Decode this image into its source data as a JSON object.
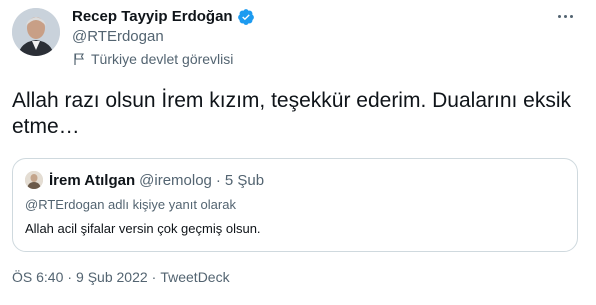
{
  "author": {
    "name": "Recep Tayyip Erdoğan",
    "handle": "@RTErdogan",
    "affiliation": "Türkiye devlet görevlisi",
    "verified_icon": "verified-badge-icon",
    "verified_color": "#1d9bf0"
  },
  "tweet": {
    "text": "Allah razı olsun İrem kızım, teşekkür ederim. Dualarını eksik etme…"
  },
  "quote": {
    "name": "İrem Atılgan",
    "handle": "@iremolog",
    "separator": "·",
    "date": "5 Şub",
    "reply_to": "@RTErdogan adlı kişiye yanıt olarak",
    "text": "Allah acil şifalar versin çok geçmiş olsun."
  },
  "footer": {
    "time": "ÖS 6:40",
    "separator": "·",
    "date": "9 Şub 2022",
    "source": "TweetDeck"
  }
}
